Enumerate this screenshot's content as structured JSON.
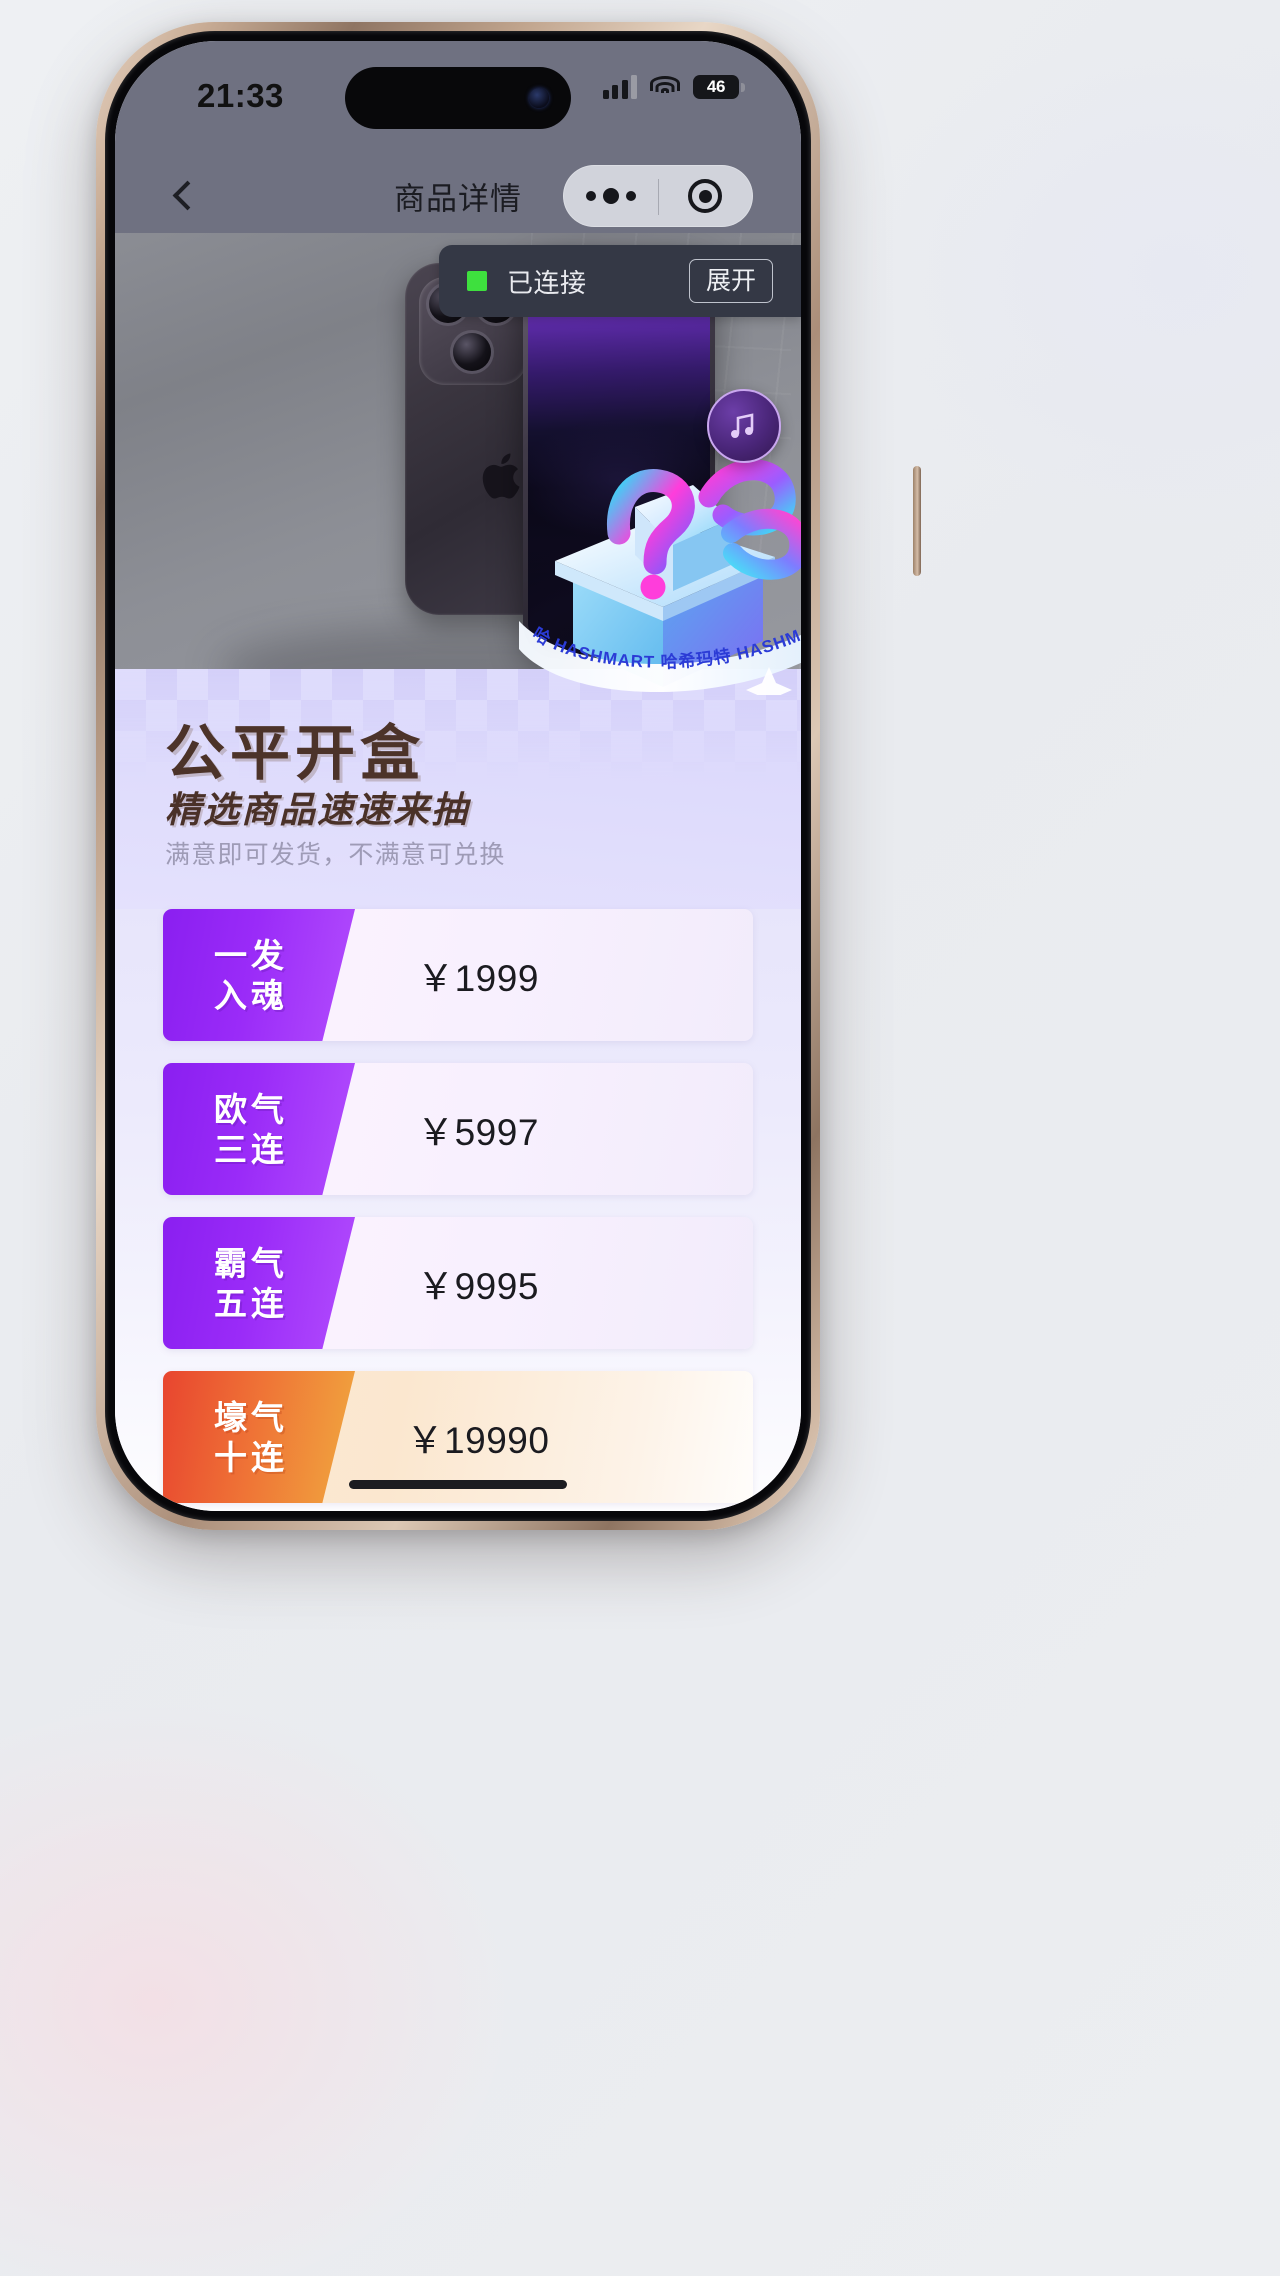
{
  "status_bar": {
    "time": "21:33",
    "battery_level": "46",
    "signal_icon": "cellular-signal-icon",
    "wifi_icon": "wifi-icon",
    "battery_icon": "battery-icon"
  },
  "nav_bar": {
    "title": "商品详情",
    "back_icon": "chevron-left-icon",
    "capsule": {
      "more_icon": "more-options-icon",
      "target_icon": "close-target-icon"
    }
  },
  "connection_banner": {
    "status_text": "已连接",
    "expand_label": "展开",
    "dot_color": "#3ee03e",
    "background": "#343845"
  },
  "hero": {
    "badge_icon": "music-note-badge-icon",
    "back_phone_icon": "iphone-rear-camera",
    "front_phone_icon": "iphone-front-screen",
    "apple_logo_icon": "apple-logo-icon"
  },
  "giftbox": {
    "ribbon_text_en": "HASHMART",
    "ribbon_text_cn": "哈希玛特",
    "question_mark": "?",
    "icon": "gift-box-icon"
  },
  "promo": {
    "title": "公平开盒",
    "subtitle": "精选商品速速来抽",
    "description": "满意即可发货，不满意可兑换"
  },
  "packages": [
    {
      "name_line1": "一发",
      "name_line2": "入魂",
      "price": "￥1999",
      "theme": "purple"
    },
    {
      "name_line1": "欧气",
      "name_line2": "三连",
      "price": "￥5997",
      "theme": "purple"
    },
    {
      "name_line1": "霸气",
      "name_line2": "五连",
      "price": "￥9995",
      "theme": "purple"
    },
    {
      "name_line1": "壕气",
      "name_line2": "十连",
      "price": "￥19990",
      "theme": "orange"
    }
  ],
  "colors": {
    "purple_accent": "#9a2bf8",
    "orange_accent": "#ef7436",
    "promo_background": "#dedbfc",
    "nav_background": "#6f7181"
  }
}
